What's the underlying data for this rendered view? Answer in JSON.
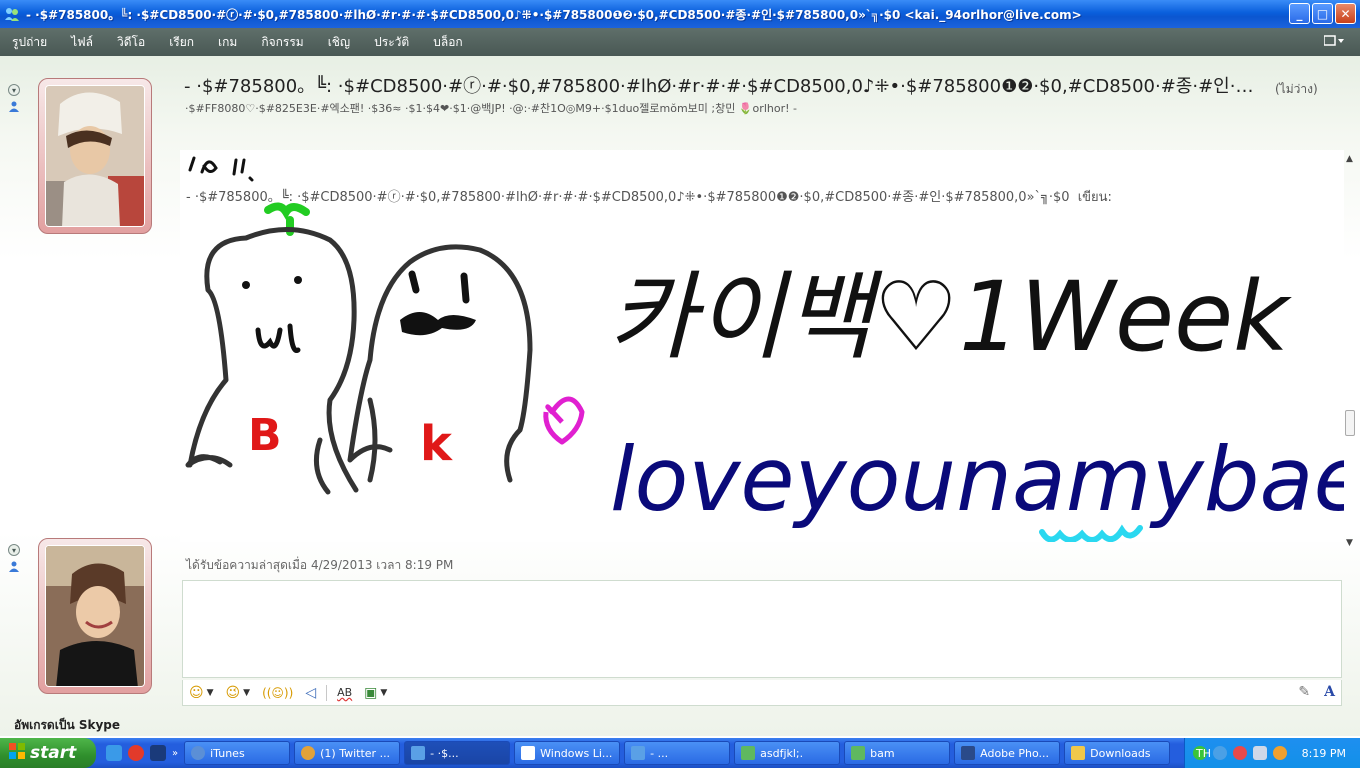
{
  "window": {
    "title": "- ·$#785800。╚: ·$#CD8500·#ⓡ·#·$0,#785800·#lhØ·#r·#·#·$#CD8500,0♪⁜•·$#785800❶❷·$0,#CD8500·#종·#인·$#785800,0»`╗·$0 <kai._94orlhor@live.com>",
    "controls": {
      "minimize": "_",
      "maximize": "□",
      "close": "✕"
    }
  },
  "menu": {
    "items": [
      "รูปถ่าย",
      "ไฟล์",
      "วิดีโอ",
      "เรียก",
      "เกม",
      "กิจกรรม",
      "เชิญ",
      "ประวัติ",
      "บล็อก"
    ],
    "overflow_glyph": "▾"
  },
  "contact": {
    "name": "- ·$#785800。╚: ·$#CD8500·#ⓡ·#·$0,#785800·#lhØ·#r·#·#·$#CD8500,0♪⁜•·$#785800❶❷·$0,#CD8500·#종·#인·…",
    "status": "(ไม่ว่าง)",
    "personal_message": "·$#FF8080♡·$#825E3E·#엑소팬! ·$36≈ ·$1·$4❤·$1·@백JP! ·@:·#찬1O◎M9+·$1duo젤로mŏm보미 ;창민 🌷orlhor! -"
  },
  "conversation": {
    "sender_line": "- ·$#785800。╚: ·$#CD8500·#ⓡ·#·$0,#785800·#lhØ·#r·#·#·$#CD8500,0♪⁜•·$#785800❶❷·$0,#CD8500·#종·#인·$#785800,0»`╗·$0",
    "writes_label": "เขียน:",
    "drawing": {
      "title_text": "카이백♡1Week",
      "subtitle_text": "loveyounamybaekt'ruk",
      "letter_b": "B",
      "letter_k": "k"
    },
    "received_notice": "ได้รับข้อความล่าสุดเมื่อ 4/29/2013 เวลา 8:19 PM"
  },
  "toolbar": {
    "emoticon_glyph": "☺",
    "wink_glyph": "😉",
    "nudge_glyph": "((☺))",
    "voice_glyph": "◁",
    "font_label": "A",
    "spell_label": "AB",
    "background_glyph": "▣",
    "handwrite_glyph": "✎"
  },
  "footer": {
    "upgrade_label": "อัพเกรดเป็น Skype"
  },
  "taskbar": {
    "start_label": "start",
    "items": [
      {
        "label": "iTunes",
        "color": "#5b8fd6"
      },
      {
        "label": "(1) Twitter ...",
        "color": "#e2a23a"
      },
      {
        "label": "- ·$...",
        "color": "#5aa0e6"
      },
      {
        "label": "Windows Li...",
        "color": "#ffffff"
      },
      {
        "label": "- ...",
        "color": "#5aa0e6"
      },
      {
        "label": "asdfjkl;.",
        "color": "#5fb85f"
      },
      {
        "label": "bam",
        "color": "#5fb85f"
      },
      {
        "label": "Adobe Pho...",
        "color": "#2a4a8a"
      },
      {
        "label": "Downloads",
        "color": "#f1c84a"
      }
    ],
    "lang": "TH",
    "clock": "8:19 PM"
  },
  "colors": {
    "title_blue": "#0a5fdc",
    "menu_bg": "#495854",
    "taskbar_blue": "#245ede",
    "start_green": "#2f8f2c",
    "drawing_black": "#111111",
    "drawing_red": "#e01818",
    "drawing_navy": "#0a0a7a",
    "drawing_cyan": "#2ad8f0",
    "drawing_magenta": "#e020d0",
    "drawing_green": "#22cc22"
  }
}
